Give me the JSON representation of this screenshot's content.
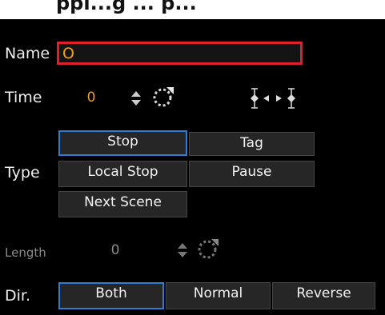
{
  "header": {
    "title": "ppi...g ... p..."
  },
  "name": {
    "label": "Name",
    "value": "O",
    "highlight_color": "#e0202a"
  },
  "time": {
    "label": "Time",
    "value": "0",
    "icons": [
      "spinner-arrows-icon",
      "reset-circle-icon",
      "keyframe-prev-icon",
      "keyframe-next-icon"
    ]
  },
  "type": {
    "label": "Type",
    "options": [
      {
        "label": "Stop",
        "selected": true
      },
      {
        "label": "Tag",
        "selected": false
      },
      {
        "label": "Local Stop",
        "selected": false
      },
      {
        "label": "Pause",
        "selected": false
      },
      {
        "label": "Next Scene",
        "selected": false
      }
    ]
  },
  "length": {
    "label": "Length",
    "value": "0",
    "disabled": true
  },
  "direction": {
    "label": "Dir.",
    "options": [
      {
        "label": "Both",
        "selected": true
      },
      {
        "label": "Normal",
        "selected": false
      },
      {
        "label": "Reverse",
        "selected": false
      }
    ]
  },
  "colors": {
    "selected_border": "#2a7fd4",
    "value_orange": "#f0a020"
  }
}
